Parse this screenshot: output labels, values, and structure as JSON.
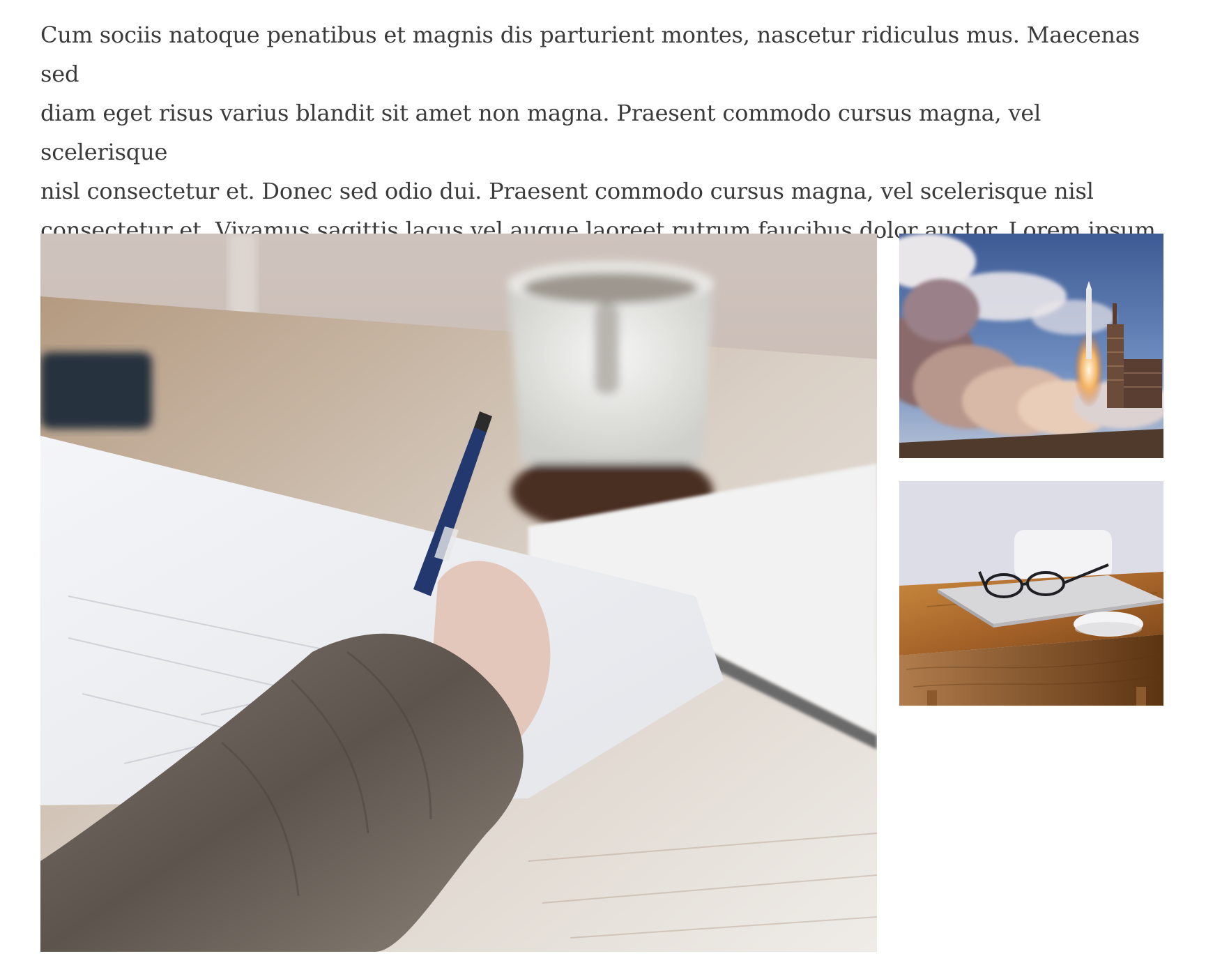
{
  "article": {
    "paragraph": "Cum sociis natoque penatibus et magnis dis parturient montes, nascetur ridiculus mus. Maecenas sed\ndiam eget risus varius blandit sit amet non magna.  Praesent commodo cursus magna, vel scelerisque\nnisl consectetur et. Donec sed odio dui. Praesent commodo cursus magna, vel scelerisque nisl\nconsectetur et. Vivamus sagittis lacus vel augue laoreet rutrum faucibus dolor auctor. Lorem ipsum\ndolor sit amet, consectetur adipiscing elit."
  },
  "gallery": {
    "images": [
      {
        "subject": "hand writing with pen on paper beside coffee mug"
      },
      {
        "subject": "rocket launch with smoke clouds"
      },
      {
        "subject": "glasses on laptop on wooden desk"
      }
    ]
  },
  "colors": {
    "text": "#3a3a3a",
    "background": "#ffffff"
  }
}
